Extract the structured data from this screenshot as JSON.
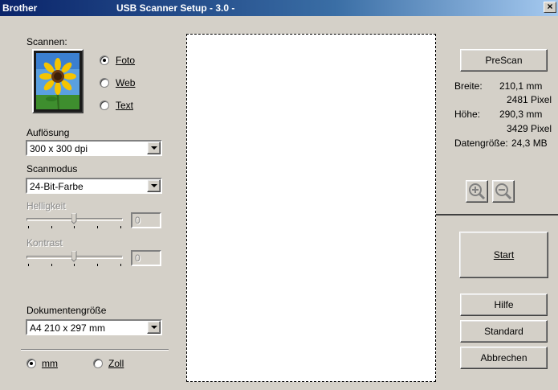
{
  "window": {
    "vendor": "Brother",
    "title": "USB Scanner Setup - 3.0 -",
    "close_glyph": "×"
  },
  "scan_type": {
    "label": "Scannen:",
    "options": [
      {
        "label": "Foto",
        "checked": true
      },
      {
        "label": "Web",
        "checked": false
      },
      {
        "label": "Text",
        "checked": false
      }
    ]
  },
  "resolution": {
    "label": "Auflösung",
    "value": "300 x 300 dpi"
  },
  "scan_mode": {
    "label": "Scanmodus",
    "value": "24-Bit-Farbe"
  },
  "brightness": {
    "label": "Helligkeit",
    "value": "0"
  },
  "contrast": {
    "label": "Kontrast",
    "value": "0"
  },
  "document_size": {
    "label": "Dokumentengröße",
    "value": "A4 210 x 297 mm"
  },
  "units": {
    "options": [
      {
        "label": "mm",
        "checked": true
      },
      {
        "label": "Zoll",
        "checked": false
      }
    ]
  },
  "info": {
    "width_label": "Breite:",
    "width_mm": "210,1 mm",
    "width_px": "2481 Pixel",
    "height_label": "Höhe:",
    "height_mm": "290,3 mm",
    "height_px": "3429 Pixel",
    "datasize_label": "Datengröße:",
    "datasize_value": "24,3 MB"
  },
  "buttons": {
    "prescan": "PreScan",
    "start": "Start",
    "help": "Hilfe",
    "standard": "Standard",
    "cancel": "Abbrechen"
  },
  "icons": {
    "zoom_in": "zoom-in-icon",
    "zoom_out": "zoom-out-icon",
    "photo": "sunflower-photo-icon"
  }
}
